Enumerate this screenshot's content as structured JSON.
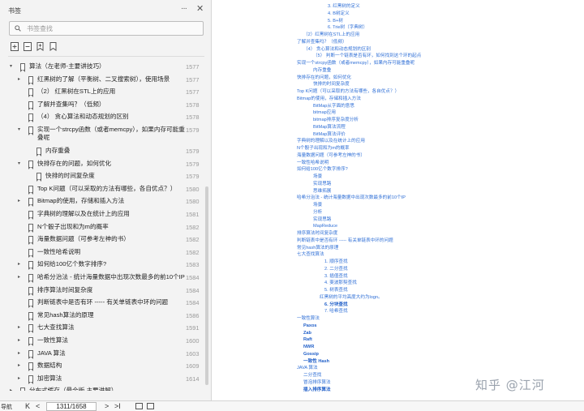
{
  "panel": {
    "title": "书签",
    "search_placeholder": "书签查找",
    "toolbar_icons": [
      "expand-all-icon",
      "collapse-all-icon",
      "add-bookmark-icon",
      "bookmark-icon"
    ]
  },
  "tree": [
    {
      "label": "算法（左老师-主要讲技巧）",
      "page": "1577",
      "indent": 0,
      "expander": "▾",
      "icon": true
    },
    {
      "label": "红黑树的了解（平衡树、二叉搜索树），使用场景",
      "page": "1577",
      "indent": 1,
      "expander": "▸",
      "icon": true
    },
    {
      "label": "（2）   红黑树在STL上的应用",
      "page": "1577",
      "indent": 1,
      "expander": "",
      "icon": true
    },
    {
      "label": "了解并查集吗？（低频）",
      "page": "1578",
      "indent": 1,
      "expander": "",
      "icon": true
    },
    {
      "label": "（4）   贪心算法和动态规划的区别",
      "page": "1578",
      "indent": 1,
      "expander": "",
      "icon": true
    },
    {
      "label": "实现一个strcpy函数（或者memcpy），如果内存可能重",
      "label2": "叠呢",
      "page": "1579",
      "indent": 1,
      "expander": "▾",
      "icon": true
    },
    {
      "label": "内存重叠",
      "page": "1579",
      "indent": 2,
      "expander": "",
      "icon": true
    },
    {
      "label": "快排存在的问题，如何优化",
      "page": "1579",
      "indent": 1,
      "expander": "▾",
      "icon": true
    },
    {
      "label": "快排的时间复杂度",
      "page": "1579",
      "indent": 2,
      "expander": "",
      "icon": true
    },
    {
      "label": "Top K问题（可以采取的方法有哪些，各自优点？）",
      "page": "1580",
      "indent": 1,
      "expander": "",
      "icon": true
    },
    {
      "label": "Bitmap的使用，存储和插入方法",
      "page": "1580",
      "indent": 1,
      "expander": "▸",
      "icon": true
    },
    {
      "label": "字典树的理解以及在统计上的应用",
      "page": "1581",
      "indent": 1,
      "expander": "",
      "icon": true
    },
    {
      "label": "N个骰子出现和为m的概率",
      "page": "1582",
      "indent": 1,
      "expander": "",
      "icon": true
    },
    {
      "label": "海量数据问题（可参考左神的书）",
      "page": "1582",
      "indent": 1,
      "expander": "",
      "icon": true
    },
    {
      "label": "一致性哈希说明",
      "page": "1582",
      "indent": 1,
      "expander": "",
      "icon": true
    },
    {
      "label": "如何给100亿个数字排序?",
      "page": "1583",
      "indent": 1,
      "expander": "▸",
      "icon": true
    },
    {
      "label": "哈希分治法 - 统计海量数据中出现次数最多的前10个IP",
      "page": "1584",
      "indent": 1,
      "expander": "▸",
      "icon": true
    },
    {
      "label": "排序算法时间复杂度",
      "page": "1584",
      "indent": 1,
      "expander": "",
      "icon": true
    },
    {
      "label": "判断链表中是否有环 ----- 有关单链表中环的问题",
      "page": "1584",
      "indent": 1,
      "expander": "",
      "icon": true
    },
    {
      "label": "常见hash算法的原理",
      "page": "1586",
      "indent": 1,
      "expander": "",
      "icon": true
    },
    {
      "label": "七大查找算法",
      "page": "1591",
      "indent": 1,
      "expander": "▸",
      "icon": true
    },
    {
      "label": "一致性算法",
      "page": "1600",
      "indent": 1,
      "expander": "▸",
      "icon": true
    },
    {
      "label": "JAVA 算法",
      "page": "1603",
      "indent": 1,
      "expander": "▸",
      "icon": true
    },
    {
      "label": "数据结构",
      "page": "1609",
      "indent": 1,
      "expander": "▸",
      "icon": true
    },
    {
      "label": "加密算法",
      "page": "1614",
      "indent": 1,
      "expander": "▸",
      "icon": true
    },
    {
      "label": "分布式缓存（最全版 主要讲解）",
      "page": "",
      "indent": 0,
      "expander": "▸",
      "icon": true
    }
  ],
  "statusbar": {
    "nav_label": "导航",
    "first": "K",
    "prev": "<",
    "page_field": "1311/1658",
    "next": ">",
    "last": ">I"
  },
  "doc_lines": [
    {
      "text": "3. 红黑树的定义",
      "indent": 4,
      "bold": false
    },
    {
      "text": "4. B树定义",
      "indent": 4,
      "bold": false
    },
    {
      "text": "5. B+树",
      "indent": 4,
      "bold": false
    },
    {
      "text": "6. Trie树（字典树）",
      "indent": 4,
      "bold": false
    },
    {
      "text": "（2）红黑树在STL上的应用",
      "indent": 1,
      "bold": false
    },
    {
      "text": "了解并查集吗？（低频）",
      "indent": 0,
      "bold": false
    },
    {
      "text": "（4）  贪心算法和动态规划的区别",
      "indent": 1,
      "bold": false
    },
    {
      "text": "（5）  判断一个链表是否有环，如何找到这个环的起点",
      "indent": 2,
      "bold": false
    },
    {
      "text": "实现一个strcpy函数（或者memcpy），如果内存可能重叠呢",
      "indent": 0,
      "bold": false
    },
    {
      "text": "内存重叠",
      "indent": 2,
      "bold": false
    },
    {
      "text": "快排存在的问题，如何优化",
      "indent": 0,
      "bold": false
    },
    {
      "text": "快排的时间复杂度",
      "indent": 2,
      "bold": false
    },
    {
      "text": "Top K问题（可以采取的方法有哪些，各自优点？）",
      "indent": 0,
      "bold": false
    },
    {
      "text": "Bitmap的使用，存储和插入方法",
      "indent": 0,
      "bold": false
    },
    {
      "text": "BitMap从字面的意思",
      "indent": 2,
      "bold": false
    },
    {
      "text": "bitmap应用",
      "indent": 2,
      "bold": false
    },
    {
      "text": "bitmap排序复杂度分析",
      "indent": 2,
      "bold": false
    },
    {
      "text": "BitMap算法流程",
      "indent": 2,
      "bold": false
    },
    {
      "text": "BitMap算法评价",
      "indent": 2,
      "bold": false
    },
    {
      "text": "字典树的理解以及在统计上的应用",
      "indent": 0,
      "bold": false
    },
    {
      "text": "N个骰子出现和为m的概率",
      "indent": 0,
      "bold": false
    },
    {
      "text": "海量数据问题（可参考左神的书）",
      "indent": 0,
      "bold": false
    },
    {
      "text": "一致性哈希说明",
      "indent": 0,
      "bold": false
    },
    {
      "text": "如何给100亿个数字排序?",
      "indent": 0,
      "bold": false
    },
    {
      "text": "场景",
      "indent": 2,
      "bold": false
    },
    {
      "text": "实现思路",
      "indent": 2,
      "bold": false
    },
    {
      "text": "思维拓展",
      "indent": 2,
      "bold": false
    },
    {
      "text": "哈希分治法 - 统计海量数据中出现次数最多的前10个IP",
      "indent": 0,
      "bold": false
    },
    {
      "text": "场景",
      "indent": 2,
      "bold": false
    },
    {
      "text": "分析",
      "indent": 2,
      "bold": false
    },
    {
      "text": "实现思路",
      "indent": 2,
      "bold": false
    },
    {
      "text": "MapReduce",
      "indent": 2,
      "bold": false
    },
    {
      "text": "排序算法时间复杂度",
      "indent": 0,
      "bold": false
    },
    {
      "text": "判断链表中是否有环 ----- 有关单链表中环的问题",
      "indent": 0,
      "bold": false
    },
    {
      "text": "常见hash算法的原理",
      "indent": 0,
      "bold": false
    },
    {
      "text": "七大查找算法",
      "indent": 0,
      "bold": false
    },
    {
      "text": "1. 顺序查找",
      "indent": 5,
      "bold": false
    },
    {
      "text": "2. 二分查找",
      "indent": 5,
      "bold": false
    },
    {
      "text": "3. 插值查找",
      "indent": 5,
      "bold": false
    },
    {
      "text": "4. 斐波那契查找",
      "indent": 5,
      "bold": false
    },
    {
      "text": "5. 树表查找",
      "indent": 5,
      "bold": false
    },
    {
      "text": "红黑树的平均高度大约为logn。",
      "indent": 3,
      "bold": false
    },
    {
      "text": "6. 分块查找",
      "indent": 5,
      "bold": true
    },
    {
      "text": "7. 哈希查找",
      "indent": 5,
      "bold": false
    },
    {
      "text": "一致性算法",
      "indent": 0,
      "bold": false
    },
    {
      "text": "Paxos",
      "indent": 1,
      "bold": true
    },
    {
      "text": "Zab",
      "indent": 1,
      "bold": true
    },
    {
      "text": "Raft",
      "indent": 1,
      "bold": true
    },
    {
      "text": "NWR",
      "indent": 1,
      "bold": true
    },
    {
      "text": "Gossip",
      "indent": 1,
      "bold": true
    },
    {
      "text": "一致性 Hash",
      "indent": 1,
      "bold": true
    },
    {
      "text": "JAVA 算法",
      "indent": 0,
      "bold": false
    },
    {
      "text": "二分查找",
      "indent": 1,
      "bold": false
    },
    {
      "text": "冒泡排序算法",
      "indent": 1,
      "bold": false
    },
    {
      "text": "插入排序算法",
      "indent": 1,
      "bold": true
    }
  ],
  "watermark": "知乎 @江河"
}
